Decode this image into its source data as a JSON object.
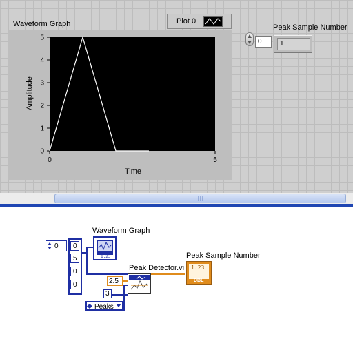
{
  "front_panel": {
    "graph": {
      "label": "Waveform Graph",
      "legend_plot_name": "Plot 0",
      "y_axis_label": "Amplitude",
      "x_axis_label": "Time",
      "y_ticks": [
        "5",
        "4",
        "3",
        "2",
        "1",
        "0"
      ],
      "x_ticks": [
        "0",
        "5"
      ],
      "plot_color": "#ffffff",
      "plot_background": "#000000"
    },
    "array_index": "0",
    "peak_indicator": {
      "label": "Peak Sample Number",
      "value": "1"
    }
  },
  "chart_data": {
    "type": "line",
    "title": "Waveform Graph",
    "xlabel": "Time",
    "ylabel": "Amplitude",
    "xlim": [
      0,
      5
    ],
    "ylim": [
      0,
      5
    ],
    "series": [
      {
        "name": "Plot 0",
        "x": [
          0,
          1,
          2,
          3
        ],
        "y": [
          0,
          5,
          0,
          0
        ]
      }
    ]
  },
  "block_diagram": {
    "graph_terminal_label": "Waveform Graph",
    "array_index": "0",
    "array_values": [
      "0",
      "5",
      "0",
      "0"
    ],
    "peak_detector_label": "Peak Detector.vi",
    "threshold_value": "2.5",
    "width_value": "3",
    "peaks_enum": "Peaks",
    "indicator_label": "Peak Sample Number",
    "indicator_type": "DBL",
    "indicator_glyph": "1.23"
  }
}
